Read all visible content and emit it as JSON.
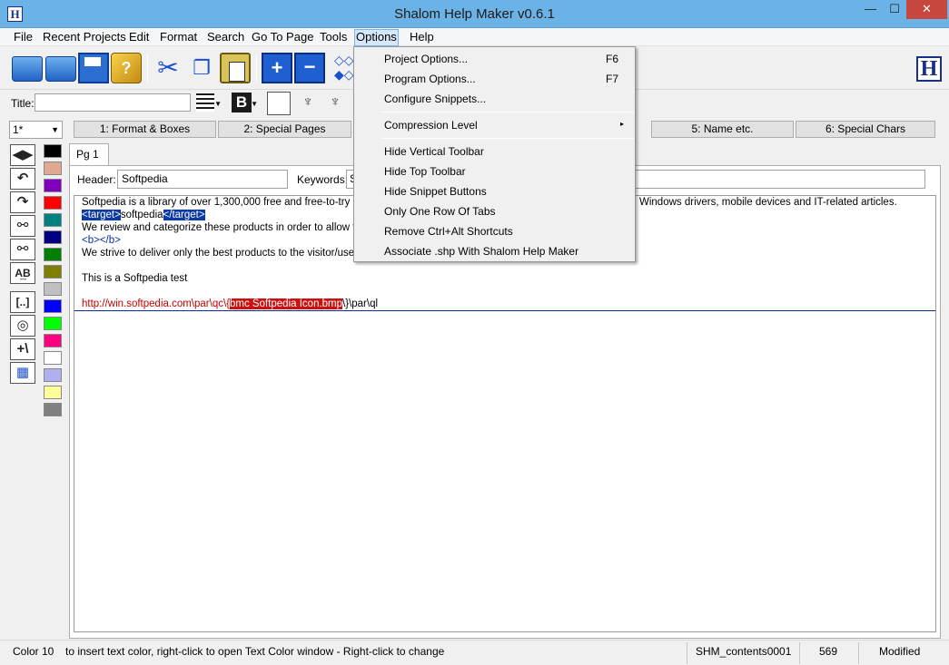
{
  "window": {
    "title": "Shalom Help Maker v0.6.1",
    "app_icon": "H"
  },
  "window_buttons": {
    "minimize": "—",
    "maximize": "☐",
    "close": "✕"
  },
  "menubar": [
    "File",
    "Recent Projects",
    "Edit",
    "Format",
    "Search",
    "Go To Page",
    "Tools",
    "Options",
    "Help"
  ],
  "toolbar": {
    "icons": [
      "open-folder-icon",
      "new-folder-icon",
      "save-icon",
      "help-book-icon",
      "cut-icon",
      "copy-icon",
      "paste-icon",
      "add-page-icon",
      "remove-page-icon",
      "diamonds-icon"
    ],
    "book_glyph": "?",
    "cut_glyph": "✂",
    "copy_glyph": "❐",
    "add_glyph": "+",
    "remove_glyph": "−",
    "diamond_glyph": "◇◇ ◆◇",
    "logo": "H"
  },
  "title_row": {
    "label": "Title:",
    "value": "",
    "bold_glyph": "B",
    "tree_glyph": "♆"
  },
  "tabs_row": {
    "page_selector": "1*",
    "tabs": [
      "1: Format & Boxes",
      "2: Special Pages",
      "5: Name etc.",
      "6: Special Chars"
    ]
  },
  "vertical_toolbar": {
    "buttons": [
      {
        "name": "prev-next-icon",
        "glyph": "◀▶"
      },
      {
        "name": "undo-icon",
        "glyph": "↶"
      },
      {
        "name": "redo-icon",
        "glyph": "↷"
      },
      {
        "name": "find-binoculars-icon",
        "glyph": "⚯"
      },
      {
        "name": "replace-binoculars-icon",
        "glyph": "⚯"
      },
      {
        "name": "a-to-b-icon",
        "glyph": "A͢B"
      },
      {
        "name": "snippet-brackets-icon",
        "glyph": "[..]"
      },
      {
        "name": "target-icon",
        "glyph": "◎"
      },
      {
        "name": "plus-slash-icon",
        "glyph": "+\\"
      },
      {
        "name": "table-icon",
        "glyph": "▦"
      }
    ],
    "colors": [
      "#000000",
      "#e0a890",
      "#8000c0",
      "#ff0000",
      "#008080",
      "#000080",
      "#008000",
      "#808000",
      "#c0c0c0",
      "#0000ff",
      "#00ff00",
      "#ff0080",
      "#ffffff",
      "#b0b0f0",
      "#ffff99",
      "#808080"
    ]
  },
  "editor": {
    "page_tab": "Pg 1",
    "header_label": "Header:",
    "header_value": "Softpedia",
    "keywords_label": "Keywords:",
    "keywords_value": "S",
    "lines": {
      "l1a": "Softpedia is a library of over 1,300,000 free and free-to-try softw",
      "l1b": "Windows drivers, mobile devices and IT-related articles.",
      "l2a": "<target>",
      "l2b": "softpedia",
      "l2c": "</target>",
      "l3": "We review and categorize these products in order to allow the v",
      "l4": "<b></b>",
      "l5": "We strive to deliver only the best products to the visitor/user tog",
      "l6": "This is a Softpedia test",
      "l7a": "http://win.softpedia.com\\par\\qc\\{",
      "l7b": "bmc Softpedia Icon.bmp",
      "l7c": "\\}\\par\\ql"
    }
  },
  "options_menu": {
    "items": [
      {
        "label": "Project Options...",
        "shortcut": "F6"
      },
      {
        "label": "Program Options...",
        "shortcut": "F7"
      },
      {
        "label": "Configure Snippets...",
        "shortcut": ""
      },
      {
        "label": "Compression Level",
        "shortcut": "",
        "submenu": "▸"
      },
      {
        "label": "Hide Vertical Toolbar",
        "shortcut": ""
      },
      {
        "label": "Hide Top Toolbar",
        "shortcut": ""
      },
      {
        "label": "Hide Snippet Buttons",
        "shortcut": ""
      },
      {
        "label": "Only One Row Of Tabs",
        "shortcut": ""
      },
      {
        "label": "Remove Ctrl+Alt Shortcuts",
        "shortcut": ""
      },
      {
        "label": "Associate .shp With Shalom Help Maker",
        "shortcut": ""
      }
    ]
  },
  "status": {
    "color_label": "Color 10",
    "hint": "to insert text color, right-click to open Text Color window  - Right-click to change",
    "context": "SHM_contents0001",
    "count": "569",
    "state": "Modified"
  }
}
